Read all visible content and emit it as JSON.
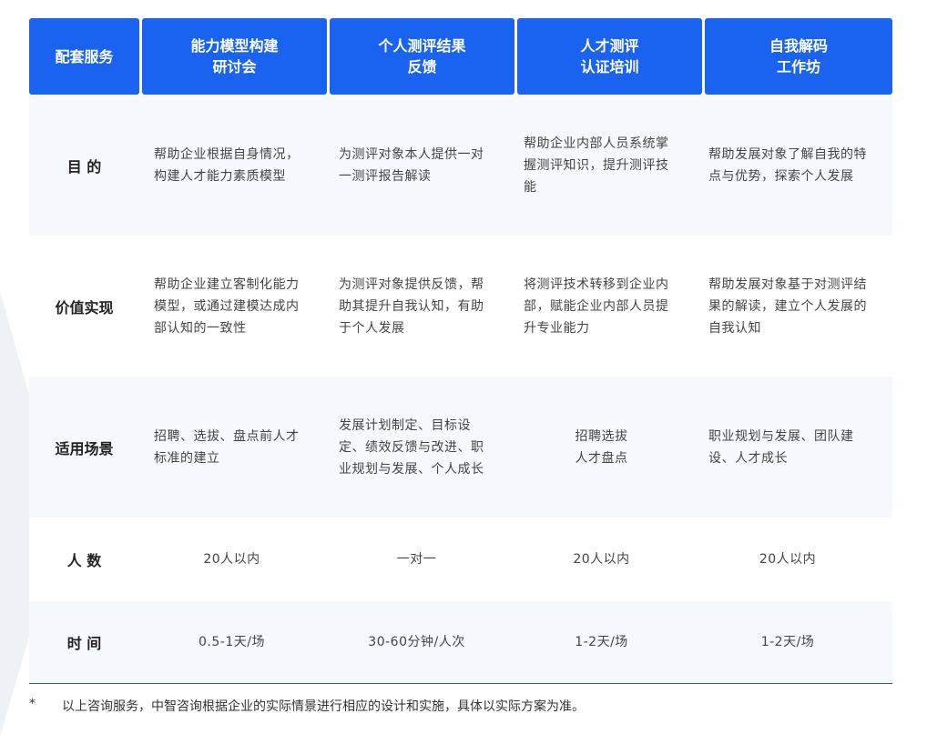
{
  "header": {
    "col0": "配套服务",
    "col1": "能力模型构建\n研讨会",
    "col2": "个人测评结果\n反馈",
    "col3": "人才测评\n认证培训",
    "col4": "自我解码\n工作坊"
  },
  "rows": [
    {
      "label": "目 的",
      "cells": [
        "帮助企业根据自身情况，构建人才能力素质模型",
        "为测评对象本人提供一对一测评报告解读",
        "帮助企业内部人员系统掌握测评知识，提升测评技能",
        "帮助发展对象了解自我的特点与优势，探索个人发展"
      ]
    },
    {
      "label": "价值实现",
      "cells": [
        "帮助企业建立客制化能力模型，或通过建模达成内部认知的一致性",
        "为测评对象提供反馈，帮助其提升自我认知，有助于个人发展",
        "将测评技术转移到企业内部，赋能企业内部人员提升专业能力",
        "帮助发展对象基于对测评结果的解读，建立个人发展的自我认知"
      ]
    },
    {
      "label": "适用场景",
      "cells": [
        "招聘、选拔、盘点前人才标准的建立",
        "发展计划制定、目标设定、绩效反馈与改进、职业规划与发展、个人成长",
        "招聘选拔\n人才盘点",
        "职业规划与发展、团队建设、人才成长"
      ]
    },
    {
      "label": "人 数",
      "cells": [
        "20人以内",
        "一对一",
        "20人以内",
        "20人以内"
      ]
    },
    {
      "label": "时 间",
      "cells": [
        "0.5-1天/场",
        "30-60分钟/人次",
        "1-2天/场",
        "1-2天/场"
      ]
    }
  ],
  "footnote": {
    "mark": "*",
    "text": "以上咨询服务，中智咨询根据企业的实际情景进行相应的设计和实施，具体以实际方案为准。"
  }
}
